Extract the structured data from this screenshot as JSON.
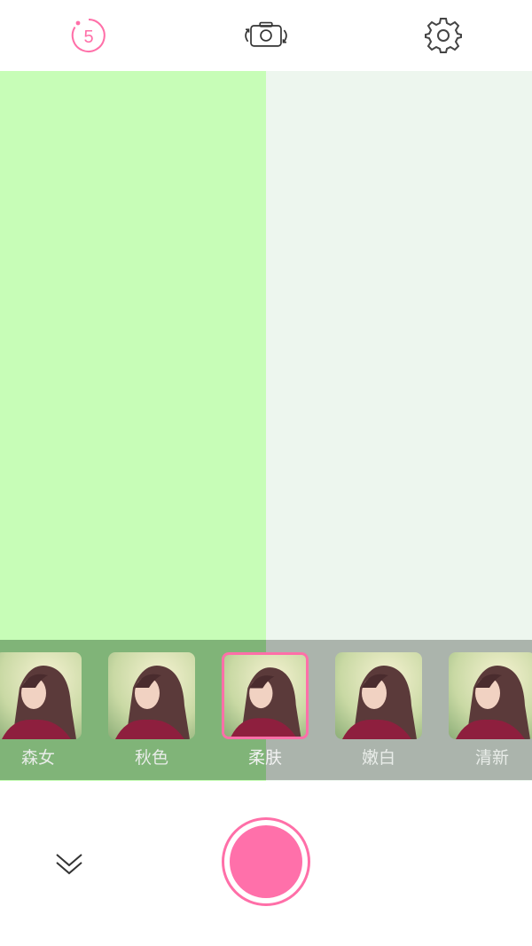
{
  "colors": {
    "accent": "#ff6fa8",
    "preview_left": "#c7fdb7",
    "preview_right": "#edf6ee"
  },
  "top_bar": {
    "timer_value": "5",
    "timer_icon": "timer-icon",
    "switch_camera_icon": "camera-switch-icon",
    "settings_icon": "gear-icon"
  },
  "filters": {
    "items": [
      {
        "label": "森女"
      },
      {
        "label": "秋色"
      },
      {
        "label": "柔肤",
        "selected": true
      },
      {
        "label": "嫩白"
      },
      {
        "label": "清新"
      }
    ]
  },
  "bottom_bar": {
    "collapse_icon": "double-chevron-down-icon",
    "shutter": "shutter-button"
  }
}
